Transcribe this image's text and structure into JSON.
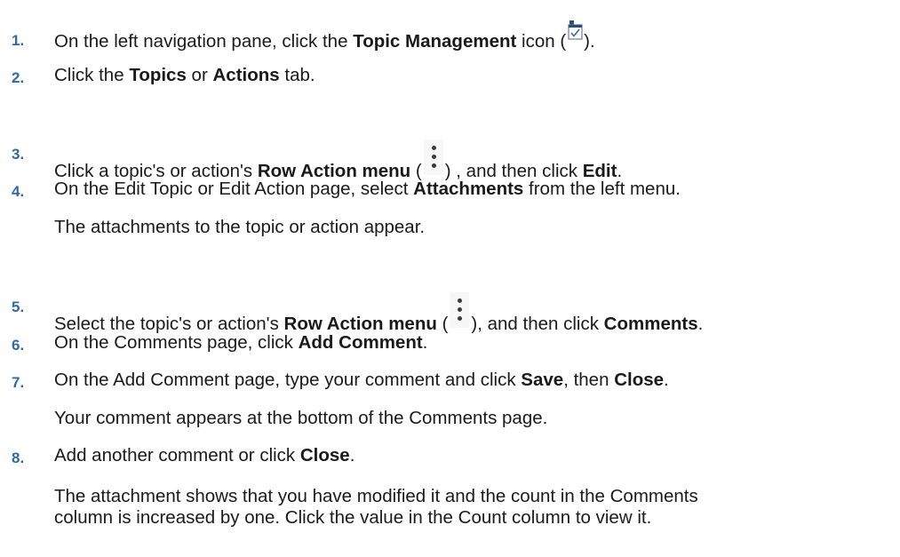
{
  "steps": [
    {
      "num": "1.",
      "pre": "On the left navigation pane, click the ",
      "b1": "Topic Management",
      "mid": " icon (",
      "post": ")."
    },
    {
      "num": "2.",
      "pre": "Click the ",
      "b1": "Topics",
      "mid": " or ",
      "b2": "Actions",
      "post": " tab."
    },
    {
      "num": "3.",
      "pre": "Click a topic's or action's ",
      "b1": "Row Action menu",
      "mid": " (",
      "post": ") , and then click ",
      "b2": "Edit",
      "end": "."
    },
    {
      "num": "4.",
      "pre": "On the Edit Topic or Edit Action page, select ",
      "b1": "Attachments",
      "post": " from the left menu.",
      "result": "The attachments to the topic or action appear."
    },
    {
      "num": "5.",
      "pre": "Select the topic's or action's ",
      "b1": "Row Action menu",
      "mid": " (",
      "post": "), and then click ",
      "b2": "Comments",
      "end": "."
    },
    {
      "num": "6.",
      "pre": "On the Comments page, click ",
      "b1": "Add Comment",
      "post": "."
    },
    {
      "num": "7.",
      "pre": "On the Add Comment page, type your comment and click ",
      "b1": "Save",
      "mid": ", then ",
      "b2": "Close",
      "post": ".",
      "result": "Your comment appears at the bottom of the Comments page."
    },
    {
      "num": "8.",
      "pre": "Add another comment or click ",
      "b1": "Close",
      "post": ".",
      "result_line1": "The attachment shows that you have modified it and the count in the Comments",
      "result_line2": "column is increased by one. Click the value in the Count column to view it."
    }
  ],
  "icons": {
    "topic_management": "topic-management-icon",
    "row_action_menu": "kebab-menu-icon"
  },
  "colors": {
    "step_number": "#2f6aa4",
    "text": "#1a1a1a"
  }
}
